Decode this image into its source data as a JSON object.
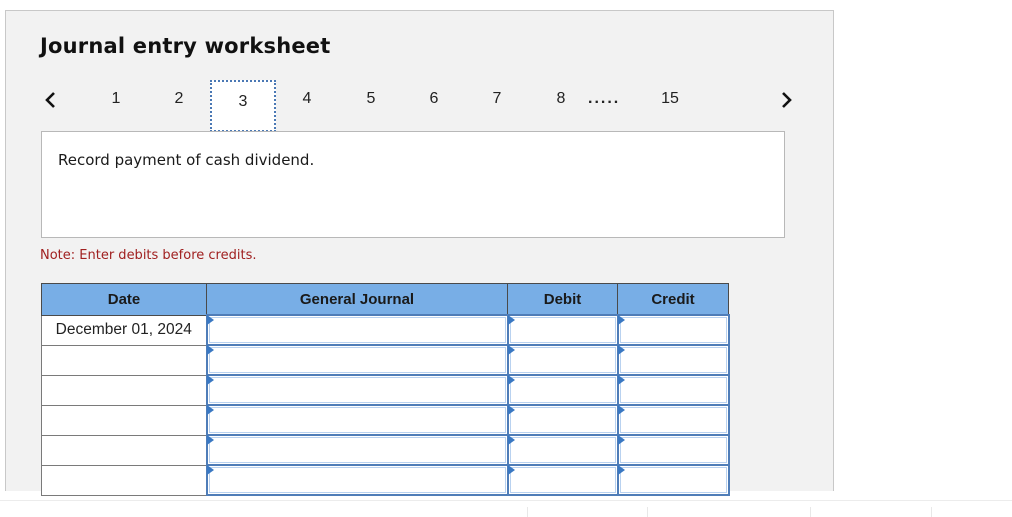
{
  "header": {
    "title": "Journal entry worksheet"
  },
  "pagination": {
    "prev_icon": "chevron-left-icon",
    "next_icon": "chevron-right-icon",
    "tabs": [
      {
        "label": "1",
        "active": false
      },
      {
        "label": "2",
        "active": false
      },
      {
        "label": "3",
        "active": true
      },
      {
        "label": "4",
        "active": false
      },
      {
        "label": "5",
        "active": false
      },
      {
        "label": "6",
        "active": false
      },
      {
        "label": "7",
        "active": false
      },
      {
        "label": "8",
        "active": false
      },
      {
        "label": "15",
        "active": false
      }
    ],
    "ellipsis": "....."
  },
  "prompt": {
    "text": "Record payment of cash dividend."
  },
  "note": "Note: Enter debits before credits.",
  "journal": {
    "columns": [
      "Date",
      "General Journal",
      "Debit",
      "Credit"
    ],
    "rows": [
      {
        "date": "December 01, 2024",
        "account": "",
        "debit": "",
        "credit": ""
      },
      {
        "date": "",
        "account": "",
        "debit": "",
        "credit": ""
      },
      {
        "date": "",
        "account": "",
        "debit": "",
        "credit": ""
      },
      {
        "date": "",
        "account": "",
        "debit": "",
        "credit": ""
      },
      {
        "date": "",
        "account": "",
        "debit": "",
        "credit": ""
      },
      {
        "date": "",
        "account": "",
        "debit": "",
        "credit": ""
      }
    ]
  },
  "colors": {
    "header_bg": "#78aee6",
    "input_border": "#4f7db8",
    "note_color": "#a02020",
    "active_tab_border": "#4a78b4"
  }
}
